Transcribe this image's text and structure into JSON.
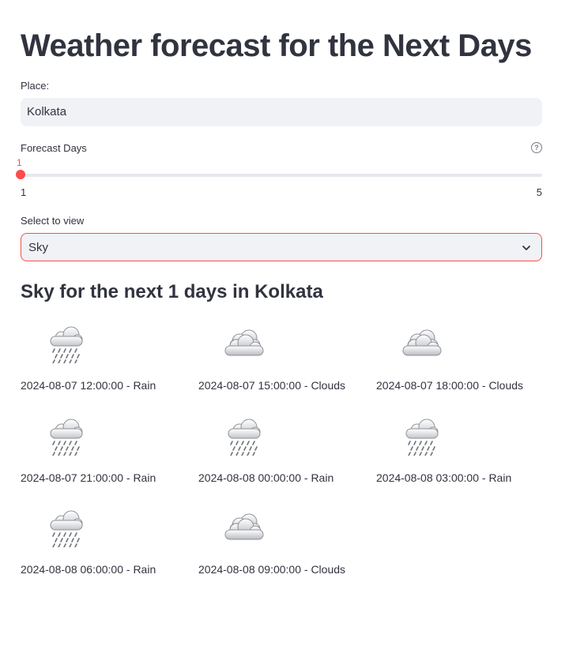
{
  "page": {
    "title": "Weather forecast for the Next Days"
  },
  "place": {
    "label": "Place:",
    "value": "Kolkata"
  },
  "forecast_days": {
    "label": "Forecast Days",
    "help_icon": "question-circle-icon",
    "value": "1",
    "min": "1",
    "max": "5",
    "fill_fraction": 0,
    "accent": "#ff4b4b"
  },
  "view_select": {
    "label": "Select to view",
    "selected": "Sky",
    "icon": "chevron-down-icon"
  },
  "results": {
    "heading": "Sky for the next 1 days in Kolkata",
    "items": [
      {
        "caption": "2024-08-07 12:00:00 - Rain",
        "icon": "rain-icon"
      },
      {
        "caption": "2024-08-07 15:00:00 - Clouds",
        "icon": "clouds-icon"
      },
      {
        "caption": "2024-08-07 18:00:00 - Clouds",
        "icon": "clouds-icon"
      },
      {
        "caption": "2024-08-07 21:00:00 - Rain",
        "icon": "rain-icon"
      },
      {
        "caption": "2024-08-08 00:00:00 - Rain",
        "icon": "rain-icon"
      },
      {
        "caption": "2024-08-08 03:00:00 - Rain",
        "icon": "rain-icon"
      },
      {
        "caption": "2024-08-08 06:00:00 - Rain",
        "icon": "rain-icon"
      },
      {
        "caption": "2024-08-08 09:00:00 - Clouds",
        "icon": "clouds-icon"
      }
    ]
  }
}
